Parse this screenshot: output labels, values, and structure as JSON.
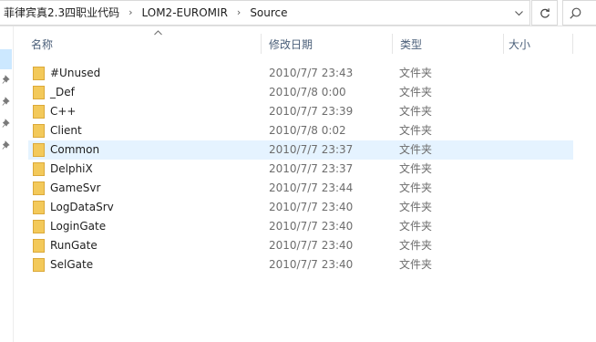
{
  "address": {
    "crumbs": [
      "菲律宾真2.3四职业代码",
      "LOM2-EUROMIR",
      "Source"
    ]
  },
  "columns": {
    "name": "名称",
    "date": "修改日期",
    "type": "类型",
    "size": "大小"
  },
  "colors": {
    "hover_row": "#e5f3ff",
    "nav_selected": "#cce8ff",
    "header_text": "#4c607a",
    "folder_icon": "#f3c95a"
  },
  "rows": [
    {
      "name": "#Unused",
      "date": "2010/7/7 23:43",
      "type": "文件夹"
    },
    {
      "name": "_Def",
      "date": "2010/7/8 0:00",
      "type": "文件夹"
    },
    {
      "name": "C++",
      "date": "2010/7/7 23:39",
      "type": "文件夹"
    },
    {
      "name": "Client",
      "date": "2010/7/8 0:02",
      "type": "文件夹"
    },
    {
      "name": "Common",
      "date": "2010/7/7 23:37",
      "type": "文件夹",
      "hover": true
    },
    {
      "name": "DelphiX",
      "date": "2010/7/7 23:37",
      "type": "文件夹"
    },
    {
      "name": "GameSvr",
      "date": "2010/7/7 23:44",
      "type": "文件夹"
    },
    {
      "name": "LogDataSrv",
      "date": "2010/7/7 23:40",
      "type": "文件夹"
    },
    {
      "name": "LoginGate",
      "date": "2010/7/7 23:40",
      "type": "文件夹"
    },
    {
      "name": "RunGate",
      "date": "2010/7/7 23:40",
      "type": "文件夹"
    },
    {
      "name": "SelGate",
      "date": "2010/7/7 23:40",
      "type": "文件夹"
    }
  ]
}
